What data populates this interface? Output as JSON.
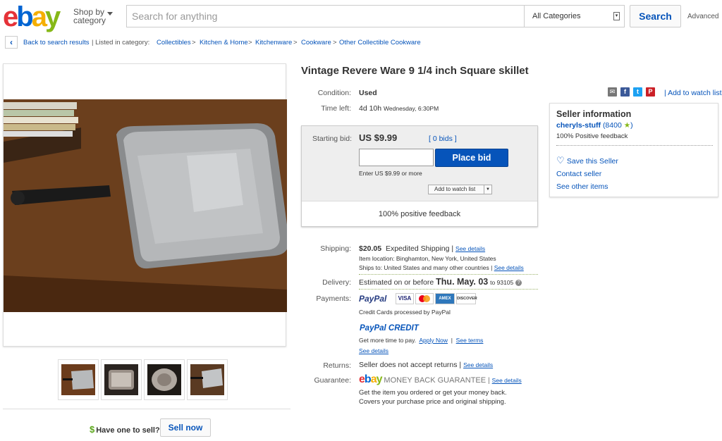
{
  "header": {
    "logo": [
      "e",
      "b",
      "a",
      "y"
    ],
    "shop_by_line1": "Shop by",
    "shop_by_line2": "category",
    "search_placeholder": "Search for anything",
    "category": "All Categories",
    "search_button": "Search",
    "advanced": "Advanced"
  },
  "breadcrumb": {
    "back": "Back to search results",
    "listed_in": "| Listed in category:",
    "items": [
      "Collectibles",
      "Kitchen & Home",
      "Kitchenware",
      "Cookware",
      "Other Collectible Cookware"
    ],
    "sep": ">"
  },
  "listing": {
    "title": "Vintage Revere Ware 9 1/4 inch Square skillet",
    "condition_label": "Condition:",
    "condition": "Used",
    "time_left_label": "Time left:",
    "time_left": "4d 10h",
    "time_left_day": "Wednesday, 6:30PM",
    "starting_bid_label": "Starting bid:",
    "starting_bid": "US $9.99",
    "bids": "[ 0 bids ]",
    "place_bid": "Place bid",
    "enter_hint": "Enter US $9.99 or more",
    "add_watch_small": "Add to watch list",
    "positive_feedback": "100% positive feedback",
    "shipping_label": "Shipping:",
    "shipping_price": "$20.05",
    "shipping_method": "Expedited Shipping",
    "see_details": "See details",
    "item_location": "Item location:  Binghamton, New York, United States",
    "ships_to": "Ships to:  United States and many other countries",
    "delivery_label": "Delivery:",
    "delivery_prefix": "Estimated on or before",
    "delivery_date": "Thu. May. 03",
    "delivery_to": "to 93105",
    "payments_label": "Payments:",
    "paypal": "PayPal",
    "card_logos": [
      "VISA",
      "MC",
      "AMEX",
      "DISCOVER"
    ],
    "credit_cards_note": "Credit Cards processed by PayPal",
    "paypal_credit": "PayPal CREDIT",
    "more_time": "Get more time to pay.",
    "apply_now": "Apply Now",
    "see_terms": "See terms",
    "returns_label": "Returns:",
    "returns": "Seller does not accept returns",
    "guarantee_label": "Guarantee:",
    "money_back": "MONEY BACK GUARANTEE",
    "guarantee_line1": "Get the item you ordered or get your money back.",
    "guarantee_line2": "Covers your purchase price and original shipping."
  },
  "share": {
    "icons": [
      "email-icon",
      "facebook-icon",
      "twitter-icon",
      "pinterest-icon"
    ],
    "add_to_watch_list": "Add to watch list"
  },
  "seller": {
    "heading": "Seller information",
    "name": "cheryls-stuff",
    "score": "(8400",
    "positive": "100% Positive feedback",
    "save": "Save this Seller",
    "contact": "Contact seller",
    "other_items": "See other items"
  },
  "sell": {
    "text": "Have one to sell?",
    "button": "Sell now"
  },
  "colors": {
    "link": "#0654ba",
    "button_blue": "#0654ba",
    "star_green": "#86b817"
  }
}
